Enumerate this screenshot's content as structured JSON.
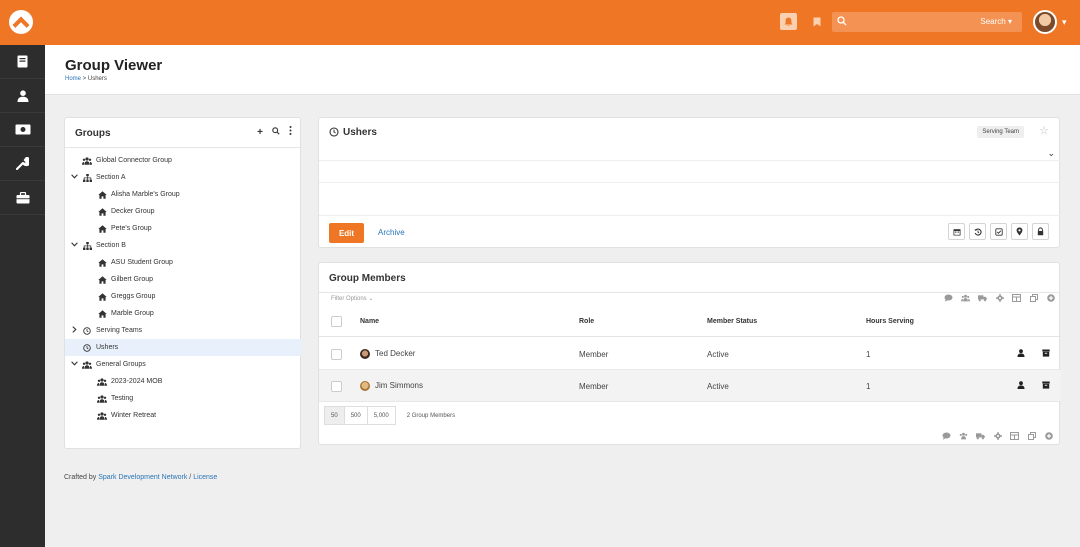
{
  "header": {
    "search_placeholder": "Search",
    "icons": [
      "rock-logo-icon",
      "bell-icon",
      "bookmark-icon",
      "search-icon",
      "avatar",
      "chevron-down-icon"
    ]
  },
  "sidenav": {
    "items": [
      "book-icon",
      "person-icon",
      "money-icon",
      "wrench-icon",
      "briefcase-icon"
    ]
  },
  "page": {
    "title": "Group Viewer",
    "breadcrumb_home": "Home",
    "breadcrumb_sep": " > ",
    "breadcrumb_current": "Ushers"
  },
  "groups_panel": {
    "title": "Groups",
    "tree": [
      {
        "label": "Global Connector Group",
        "icon": "users-icon",
        "caret": ""
      },
      {
        "label": "Section A",
        "icon": "sitemap-icon",
        "caret": "v"
      },
      {
        "label": "Alisha Marble's Group",
        "icon": "home-icon",
        "caret": ""
      },
      {
        "label": "Decker Group",
        "icon": "home-icon",
        "caret": ""
      },
      {
        "label": "Pete's Group",
        "icon": "home-icon",
        "caret": ""
      },
      {
        "label": "Section B",
        "icon": "sitemap-icon",
        "caret": "v"
      },
      {
        "label": "ASU Student Group",
        "icon": "home-icon",
        "caret": ""
      },
      {
        "label": "Gilbert Group",
        "icon": "home-icon",
        "caret": ""
      },
      {
        "label": "Greggs Group",
        "icon": "home-icon",
        "caret": ""
      },
      {
        "label": "Marble Group",
        "icon": "home-icon",
        "caret": ""
      },
      {
        "label": "Serving Teams",
        "icon": "clock-icon",
        "caret": ">"
      },
      {
        "label": "Ushers",
        "icon": "clock-icon",
        "caret": "",
        "selected": true
      },
      {
        "label": "General Groups",
        "icon": "users-icon",
        "caret": "v"
      },
      {
        "label": "2023-2024 MOB",
        "icon": "users-icon",
        "caret": ""
      },
      {
        "label": "Testing",
        "icon": "users-icon",
        "caret": ""
      },
      {
        "label": "Winter Retreat",
        "icon": "users-icon",
        "caret": ""
      }
    ]
  },
  "group_detail": {
    "title": "Ushers",
    "tag": "Serving Team",
    "edit_label": "Edit",
    "archive_label": "Archive"
  },
  "members": {
    "title": "Group Members",
    "filter_label": "Filter Options",
    "columns": {
      "name": "Name",
      "role": "Role",
      "status": "Member Status",
      "hours": "Hours Serving"
    },
    "rows": [
      {
        "name": "Ted Decker",
        "role": "Member",
        "status": "Active",
        "hours": "1"
      },
      {
        "name": "Jim Simmons",
        "role": "Member",
        "status": "Active",
        "hours": "1"
      }
    ],
    "page_sizes": [
      "50",
      "500",
      "5,000"
    ],
    "count_label": "2 Group Members"
  },
  "footer": {
    "prefix": "Crafted by ",
    "link1": "Spark Development Network",
    "sep": " / ",
    "link2": "License"
  }
}
